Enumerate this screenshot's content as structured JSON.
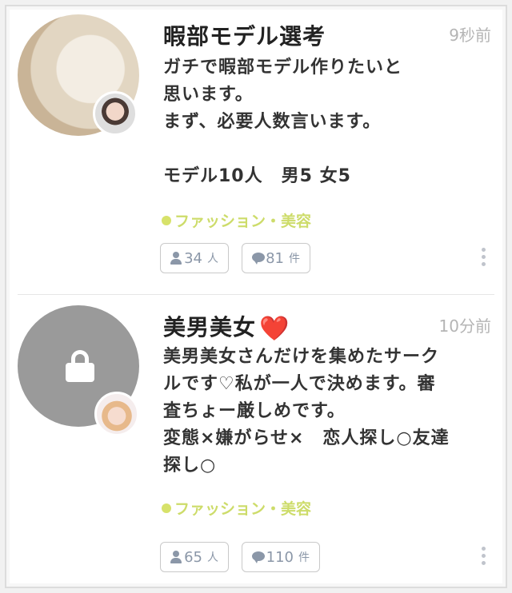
{
  "posts": [
    {
      "title": "暇部モデル選考",
      "time": "9秒前",
      "body": "ガチで暇部モデル作りたいと\n思います。\nまず、必要人数言います。\n\nモデル10人　男5 女5",
      "category": "ファッション・美容",
      "members_count": "34",
      "members_unit": "人",
      "posts_count": "81",
      "posts_unit": "件"
    },
    {
      "title": "美男美女",
      "title_emoji": "❤️",
      "time": "10分前",
      "body": "美男美女さんだけを集めたサーク\nルです♡私が一人で決めます。審\n査ちょー厳しめです。\n変態×嫌がらせ×　恋人探し○友達\n探し○",
      "category": "ファッション・美容",
      "members_count": "65",
      "members_unit": "人",
      "posts_count": "110",
      "posts_unit": "件"
    }
  ],
  "icons": {
    "members": "person-icon",
    "posts": "speech-bubble-icon",
    "more": "kebab-menu-icon",
    "locked": "lock-icon"
  },
  "colors": {
    "category": "#cddc6a",
    "time": "#b5b5b5",
    "chip_text": "#8b97a8"
  }
}
